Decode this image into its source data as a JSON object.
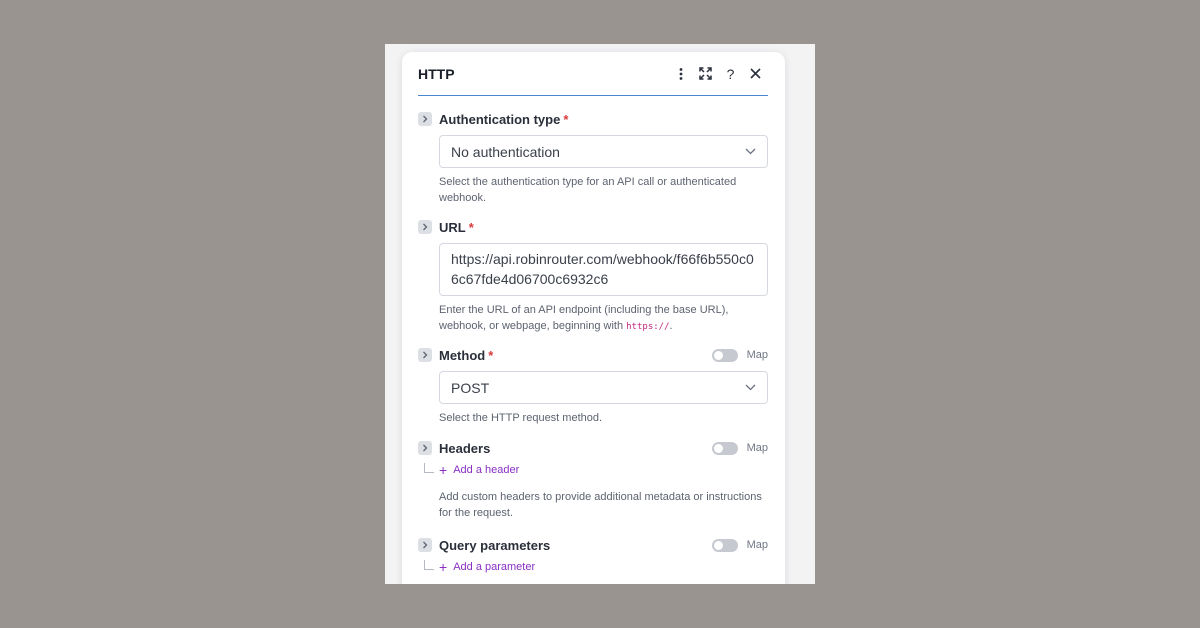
{
  "panel": {
    "title": "HTTP",
    "icons": [
      "kebab-menu-icon",
      "expand-icon",
      "help-icon",
      "close-icon"
    ],
    "help_glyph": "?"
  },
  "fields": {
    "auth": {
      "label": "Authentication type",
      "required": "*",
      "value": "No authentication",
      "help": "Select the authentication type for an API call or authenticated webhook."
    },
    "url": {
      "label": "URL",
      "required": "*",
      "value": "https://api.robinrouter.com/webhook/f66f6b550c06c67fde4d06700c6932c6",
      "help_prefix": "Enter the URL of an API endpoint (including the base URL), webhook, or webpage, beginning with ",
      "help_code": "https://",
      "help_suffix": "."
    },
    "method": {
      "label": "Method",
      "required": "*",
      "map_label": "Map",
      "value": "POST",
      "help": "Select the HTTP request method."
    },
    "headers": {
      "label": "Headers",
      "map_label": "Map",
      "add_label": "Add a header",
      "help": "Add custom headers to provide additional metadata or instructions for the request."
    },
    "query": {
      "label": "Query parameters",
      "map_label": "Map",
      "add_label": "Add a parameter"
    }
  },
  "colors": {
    "accent_line": "#4a86d0",
    "required": "#d93a3a",
    "link": "#8a2fc4",
    "code": "#c2267e"
  }
}
